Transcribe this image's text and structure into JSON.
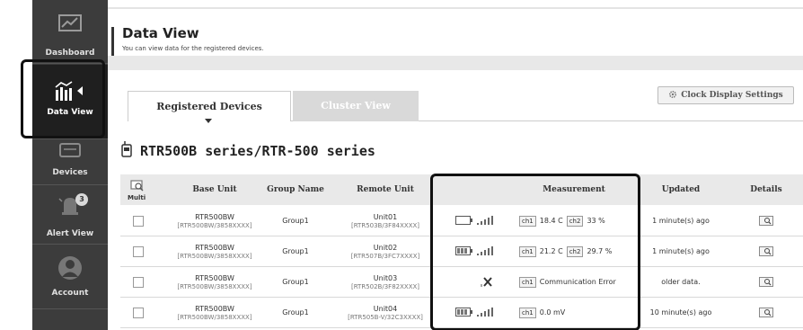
{
  "sidebar": {
    "items": [
      {
        "label": "Dashboard",
        "icon": "dashboard-icon"
      },
      {
        "label": "Data View",
        "icon": "data-view-icon",
        "active": true
      },
      {
        "label": "Devices",
        "icon": "devices-icon"
      },
      {
        "label": "Alert View",
        "icon": "alert-bell-icon",
        "badge": "3"
      },
      {
        "label": "Account",
        "icon": "account-icon"
      }
    ]
  },
  "header": {
    "title": "Data View",
    "subtitle": "You can view data for the registered devices."
  },
  "tabs": [
    {
      "label": "Registered Devices",
      "active": true
    },
    {
      "label": "Cluster View",
      "active": false
    }
  ],
  "clock_button": {
    "label": "Clock Display Settings",
    "icon": "gear-icon"
  },
  "series_heading": "RTR500B series/RTR-500 series",
  "table": {
    "multi_label": "Multi",
    "columns": [
      "Base Unit",
      "Group Name",
      "Remote Unit",
      "Measurement",
      "Updated",
      "Details"
    ],
    "rows": [
      {
        "base_unit": "RTR500BW",
        "base_serial": "[RTR500BW/3858XXXX]",
        "group": "Group1",
        "remote_unit": "Unit01",
        "remote_serial": "[RTR503B/3F84XXXX]",
        "battery": "low",
        "signal": "full",
        "ch1_label": "ch1",
        "ch1_value": "18.4 C",
        "ch2_label": "ch2",
        "ch2_value": "33 %",
        "updated": "1 minute(s) ago"
      },
      {
        "base_unit": "RTR500BW",
        "base_serial": "[RTR500BW/3858XXXX]",
        "group": "Group1",
        "remote_unit": "Unit02",
        "remote_serial": "[RTR507B/3FC7XXXX]",
        "battery": "full",
        "signal": "full",
        "ch1_label": "ch1",
        "ch1_value": "21.2 C",
        "ch2_label": "ch2",
        "ch2_value": "29.7 %",
        "updated": "1 minute(s) ago"
      },
      {
        "base_unit": "RTR500BW",
        "base_serial": "[RTR500BW/3858XXXX]",
        "group": "Group1",
        "remote_unit": "Unit03",
        "remote_serial": "[RTR502B/3F82XXXX]",
        "battery": "none",
        "signal": "none",
        "ch1_label": "ch1",
        "ch1_value": "Communication Error",
        "ch2_label": "",
        "ch2_value": "",
        "updated": "older data."
      },
      {
        "base_unit": "RTR500BW",
        "base_serial": "[RTR500BW/3858XXXX]",
        "group": "Group1",
        "remote_unit": "Unit04",
        "remote_serial": "[RTR505B-V/32C3XXXX]",
        "battery": "full",
        "signal": "full",
        "ch1_label": "ch1",
        "ch1_value": "0.0 mV",
        "ch2_label": "",
        "ch2_value": "",
        "updated": "10 minute(s) ago"
      }
    ]
  }
}
